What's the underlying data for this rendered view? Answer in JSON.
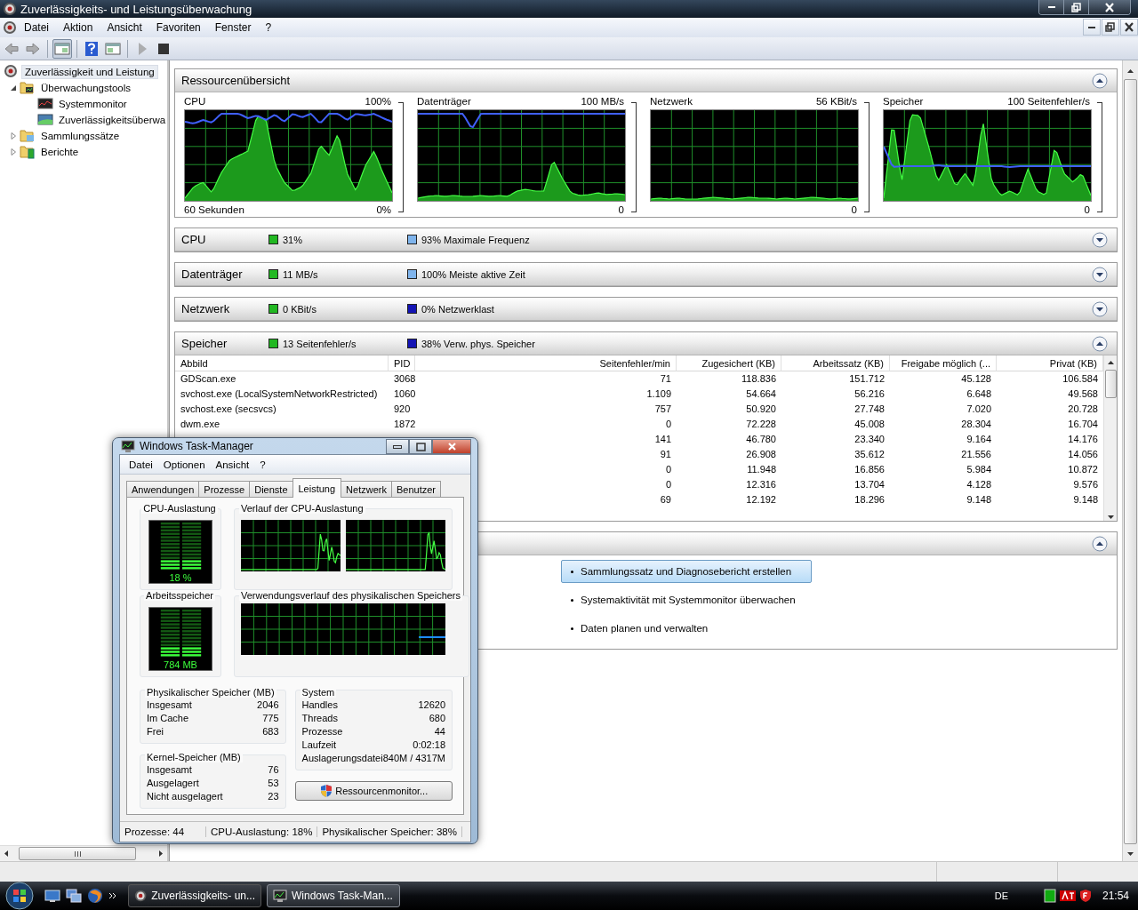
{
  "window": {
    "title": "Zuverlässigkeits- und Leistungsüberwachung"
  },
  "menu": [
    "Datei",
    "Aktion",
    "Ansicht",
    "Favoriten",
    "Fenster",
    "?"
  ],
  "toolbar": [
    {
      "kind": "back",
      "disabled": true
    },
    {
      "kind": "forward",
      "disabled": true
    },
    {
      "kind": "sep"
    },
    {
      "kind": "tree",
      "disabled": false,
      "pressed": true
    },
    {
      "kind": "sep"
    },
    {
      "kind": "help",
      "disabled": false
    },
    {
      "kind": "panel",
      "disabled": false,
      "pressed": false
    },
    {
      "kind": "sep"
    },
    {
      "kind": "play",
      "disabled": true
    },
    {
      "kind": "stop",
      "disabled": false
    }
  ],
  "tree": [
    {
      "label": "Zuverlässigkeit und Leistung",
      "kind": "root",
      "selected": true,
      "children": [
        {
          "label": "Überwachungstools",
          "kind": "tools",
          "selected": false,
          "expanded": true,
          "children": [
            {
              "label": "Systemmonitor",
              "kind": "monitor",
              "selected": false
            },
            {
              "label": "Zuverlässigkeitsüberwa",
              "kind": "reliability",
              "selected": false
            }
          ]
        },
        {
          "label": "Sammlungssätze",
          "kind": "sets",
          "selected": false,
          "expanded": false
        },
        {
          "label": "Berichte",
          "kind": "reports",
          "selected": false,
          "expanded": false
        }
      ]
    }
  ],
  "overview": {
    "title": "Ressourcenübersicht",
    "expanded": true,
    "graphs": [
      {
        "label": "CPU",
        "max": "100%",
        "min": "0%",
        "footer": "60 Sekunden"
      },
      {
        "label": "Datenträger",
        "max": "100 MB/s",
        "min": "0"
      },
      {
        "label": "Netzwerk",
        "max": "56 KBit/s",
        "min": "0"
      },
      {
        "label": "Speicher",
        "max": "100 Seitenfehler/s",
        "min": "0"
      }
    ]
  },
  "sections": [
    {
      "kind": "summary",
      "title": "CPU",
      "expanded": false,
      "legend": [
        {
          "text": "31%",
          "color": "#22b822"
        },
        {
          "text": "93% Maximale Frequenz",
          "color": "#7fb4ec"
        }
      ]
    },
    {
      "kind": "summary",
      "title": "Datenträger",
      "expanded": false,
      "legend": [
        {
          "text": "11 MB/s",
          "color": "#22b822"
        },
        {
          "text": "100% Meiste aktive Zeit",
          "color": "#7fb4ec"
        }
      ]
    },
    {
      "kind": "summary",
      "title": "Netzwerk",
      "expanded": false,
      "legend": [
        {
          "text": "0 KBit/s",
          "color": "#22b822"
        },
        {
          "text": "0% Netzwerklast",
          "color": "#1414b4"
        }
      ]
    },
    {
      "kind": "table",
      "title": "Speicher",
      "expanded": true,
      "legend": [
        {
          "text": "13 Seitenfehler/s",
          "color": "#22b822"
        },
        {
          "text": "38% Verw. phys. Speicher",
          "color": "#1414b4"
        }
      ],
      "table": {
        "columns": [
          "Abbild",
          "PID",
          "Seitenfehler/min",
          "Zugesichert (KB)",
          "Arbeitssatz (KB)",
          "Freigabe möglich (...",
          "Privat (KB)"
        ],
        "rows": [
          [
            "GDScan.exe",
            "3068",
            "71",
            "118.836",
            "151.712",
            "45.128",
            "106.584"
          ],
          [
            "svchost.exe (LocalSystemNetworkRestricted)",
            "1060",
            "1.109",
            "54.664",
            "56.216",
            "6.648",
            "49.568"
          ],
          [
            "svchost.exe (secsvcs)",
            "920",
            "757",
            "50.920",
            "27.748",
            "7.020",
            "20.728"
          ],
          [
            "dwm.exe",
            "1872",
            "0",
            "72.228",
            "45.008",
            "28.304",
            "16.704"
          ],
          [
            null,
            null,
            "141",
            "46.780",
            "23.340",
            "9.164",
            "14.176"
          ],
          [
            null,
            null,
            "91",
            "26.908",
            "35.612",
            "21.556",
            "14.056"
          ],
          [
            null,
            null,
            "0",
            "11.948",
            "16.856",
            "5.984",
            "10.872"
          ],
          [
            null,
            null,
            "0",
            "12.316",
            "13.704",
            "4.128",
            "9.576"
          ],
          [
            null,
            null,
            "69",
            "12.192",
            "18.296",
            "9.148",
            "9.148"
          ]
        ]
      }
    },
    {
      "kind": "links",
      "expanded": true,
      "links": [
        {
          "label": "Sammlungssatz und Diagnosebericht erstellen",
          "selected": true
        },
        {
          "label": "Systemaktivität mit Systemmonitor überwachen",
          "selected": false
        },
        {
          "label": "Daten planen und verwalten",
          "selected": false
        }
      ]
    }
  ],
  "task_manager": {
    "title": "Windows Task-Manager",
    "menu": [
      "Datei",
      "Optionen",
      "Ansicht",
      "?"
    ],
    "tabs": [
      {
        "label": "Anwendungen",
        "selected": false
      },
      {
        "label": "Prozesse",
        "selected": false
      },
      {
        "label": "Dienste",
        "selected": false
      },
      {
        "label": "Leistung",
        "selected": true
      },
      {
        "label": "Netzwerk",
        "selected": false
      },
      {
        "label": "Benutzer",
        "selected": false
      }
    ],
    "cpu_usage": {
      "title": "CPU-Auslastung",
      "reading": "18 %",
      "level": 0.18
    },
    "cpu_history": {
      "title": "Verlauf der CPU-Auslastung"
    },
    "memory": {
      "title": "Arbeitsspeicher",
      "reading": "784 MB",
      "level": 0.22
    },
    "memory_history": {
      "title": "Verwendungsverlauf des physikalischen Speichers"
    },
    "physical": {
      "title": "Physikalischer Speicher (MB)",
      "rows": [
        {
          "label": "Insgesamt",
          "value": "2046"
        },
        {
          "label": "Im Cache",
          "value": "775"
        },
        {
          "label": "Frei",
          "value": "683"
        }
      ]
    },
    "kernel": {
      "title": "Kernel-Speicher (MB)",
      "rows": [
        {
          "label": "Insgesamt",
          "value": "76"
        },
        {
          "label": "Ausgelagert",
          "value": "53"
        },
        {
          "label": "Nicht ausgelagert",
          "value": "23"
        }
      ]
    },
    "system": {
      "title": "System",
      "rows": [
        {
          "label": "Handles",
          "value": "12620"
        },
        {
          "label": "Threads",
          "value": "680"
        },
        {
          "label": "Prozesse",
          "value": "44"
        },
        {
          "label": "Laufzeit",
          "value": "0:02:18"
        },
        {
          "label": "Auslagerungsdatei",
          "value": "840M / 4317M"
        }
      ]
    },
    "button": "Ressourcenmonitor...",
    "status": [
      "Prozesse: 44",
      "CPU-Auslastung: 18%",
      "Physikalischer Speicher: 38%"
    ]
  },
  "taskbar": {
    "tasks": [
      {
        "label": "Zuverlässigkeits- un...",
        "selected": false
      },
      {
        "label": "Windows Task-Man...",
        "selected": true
      }
    ],
    "language": "DE",
    "clock": "21:54"
  }
}
